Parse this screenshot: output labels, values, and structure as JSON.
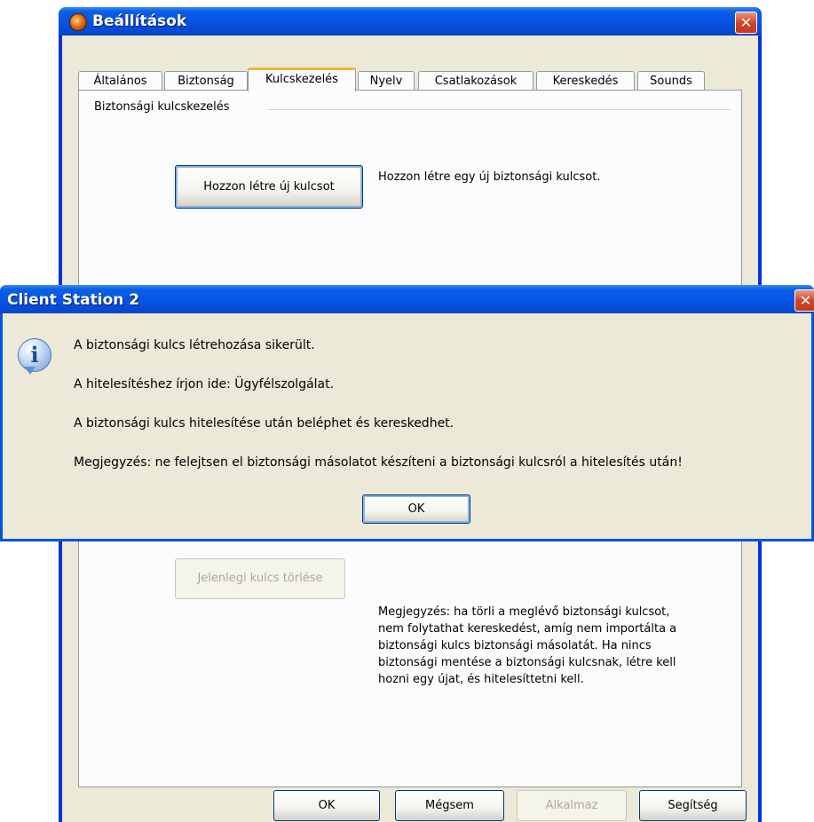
{
  "settings_window": {
    "title": "Beállítások",
    "close_glyph": "✕",
    "tabs": [
      {
        "label": "Általános",
        "active": false
      },
      {
        "label": "Biztonság",
        "active": false
      },
      {
        "label": "Kulcskezelés",
        "active": true
      },
      {
        "label": "Nyelv",
        "active": false
      },
      {
        "label": "Csatlakozások",
        "active": false
      },
      {
        "label": "Kereskedés",
        "active": false
      },
      {
        "label": "Sounds",
        "active": false
      }
    ],
    "group_title": "Biztonsági kulcskezelés",
    "create_key_button": "Hozzon létre új kulcsot",
    "create_key_desc": "Hozzon létre egy új biztonsági kulcsot.",
    "delete_key_button": "Jelenlegi kulcs törlése",
    "delete_key_note": "Megjegyzés: ha törli a meglévő biztonsági kulcsot, nem folytathat kereskedést, amíg nem importálta a biztonsági kulcs biztonsági másolatát. Ha nincs biztonsági mentése a biztonsági kulcsnak, létre kell hozni egy újat, és hitelesíttetni kell.",
    "buttons": {
      "ok": "OK",
      "cancel": "Mégsem",
      "apply": "Alkalmaz",
      "help": "Segítség"
    }
  },
  "message_box": {
    "title": "Client Station 2",
    "close_glyph": "✕",
    "icon_glyph": "i",
    "lines": [
      "A biztonsági kulcs létrehozása sikerült.",
      "A hitelesítéshez írjon ide: Ügyfélszolgálat.",
      "A biztonsági kulcs hitelesítése után beléphet és kereskedhet.",
      "Megjegyzés: ne felejtsen el biztonsági másolatot készíteni a biztonsági kulcsról a hitelesítés után!"
    ],
    "ok_button": "OK"
  }
}
